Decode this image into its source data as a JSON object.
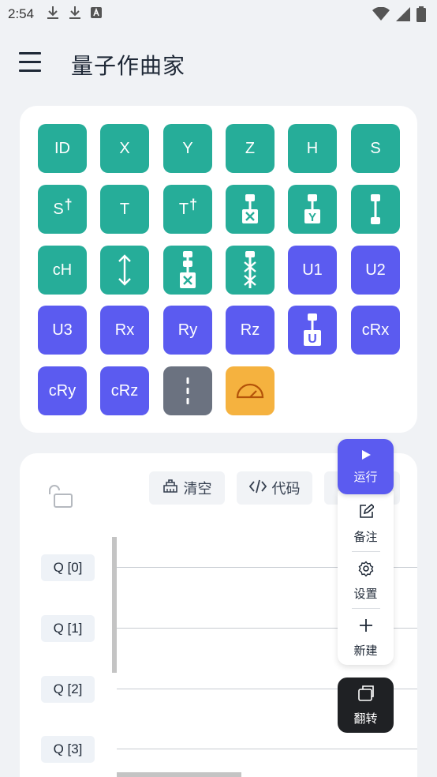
{
  "status_bar": {
    "time": "2:54"
  },
  "app_bar": {
    "title": "量子作曲家"
  },
  "gates": [
    {
      "label": "ID",
      "icon": "",
      "color": "teal"
    },
    {
      "label": "X",
      "icon": "",
      "color": "teal"
    },
    {
      "label": "Y",
      "icon": "",
      "color": "teal"
    },
    {
      "label": "Z",
      "icon": "",
      "color": "teal"
    },
    {
      "label": "H",
      "icon": "",
      "color": "teal"
    },
    {
      "label": "S",
      "icon": "",
      "color": "teal"
    },
    {
      "label": "S",
      "sup": "†",
      "icon": "",
      "color": "teal"
    },
    {
      "label": "T",
      "icon": "",
      "color": "teal"
    },
    {
      "label": "T",
      "sup": "†",
      "icon": "",
      "color": "teal"
    },
    {
      "label": "",
      "icon": "cx-icon",
      "color": "teal"
    },
    {
      "label": "",
      "icon": "cy-icon",
      "color": "teal"
    },
    {
      "label": "",
      "icon": "cz-icon",
      "color": "teal"
    },
    {
      "label": "cH",
      "icon": "",
      "color": "teal"
    },
    {
      "label": "",
      "icon": "swap-icon",
      "color": "teal"
    },
    {
      "label": "",
      "icon": "ccx-icon",
      "color": "teal"
    },
    {
      "label": "",
      "icon": "cswap-icon",
      "color": "teal"
    },
    {
      "label": "U1",
      "icon": "",
      "color": "indigo"
    },
    {
      "label": "U2",
      "icon": "",
      "color": "indigo"
    },
    {
      "label": "U3",
      "icon": "",
      "color": "indigo"
    },
    {
      "label": "Rx",
      "icon": "",
      "color": "indigo"
    },
    {
      "label": "Ry",
      "icon": "",
      "color": "indigo"
    },
    {
      "label": "Rz",
      "icon": "",
      "color": "indigo"
    },
    {
      "label": "",
      "icon": "cu-icon",
      "color": "indigo"
    },
    {
      "label": "cRx",
      "icon": "",
      "color": "indigo"
    },
    {
      "label": "cRy",
      "icon": "",
      "color": "indigo"
    },
    {
      "label": "cRz",
      "icon": "",
      "color": "indigo"
    },
    {
      "label": "",
      "icon": "barrier-icon",
      "color": "gray"
    },
    {
      "label": "",
      "icon": "measure-icon",
      "color": "orange"
    }
  ],
  "toolbar": {
    "clear_label": "清空",
    "code_label": "代码"
  },
  "qubits": [
    "Q [0]",
    "Q [1]",
    "Q [2]",
    "Q [3]"
  ],
  "fab": {
    "run_label": "运行",
    "note_label": "备注",
    "settings_label": "设置",
    "new_label": "新建",
    "flip_label": "翻转"
  },
  "colors": {
    "teal": "#26ad99",
    "indigo": "#5b5bf0",
    "gray": "#6b7280",
    "orange": "#f5b23f"
  }
}
